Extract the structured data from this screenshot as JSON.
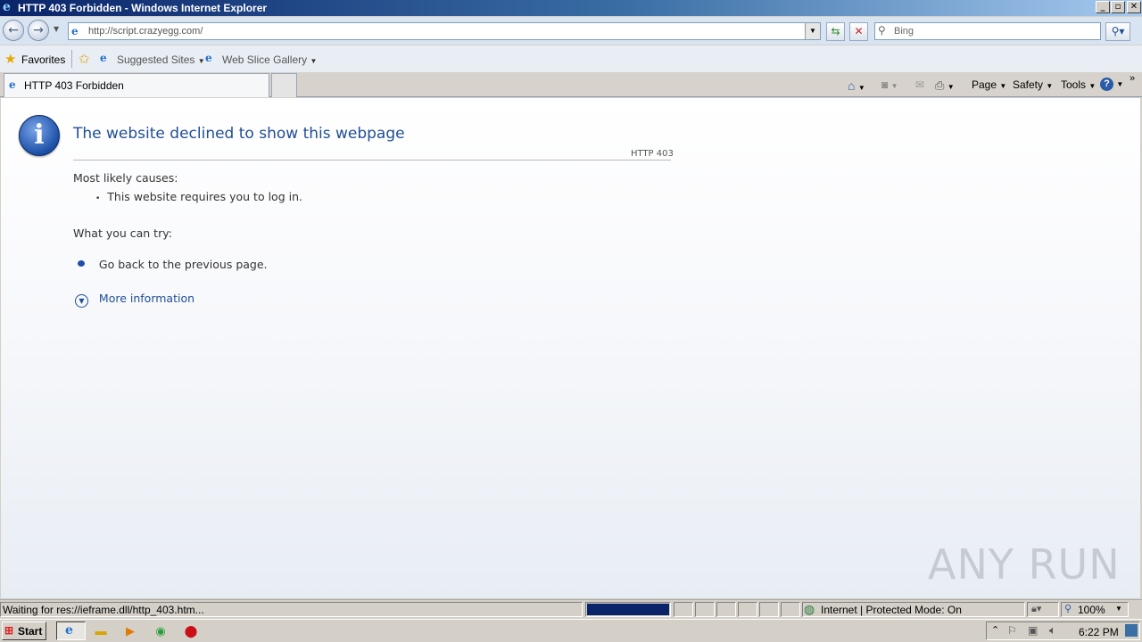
{
  "window": {
    "title": "HTTP 403 Forbidden - Windows Internet Explorer"
  },
  "nav": {
    "address": "http://script.crazyegg.com/",
    "search_placeholder": "Bing"
  },
  "favorites_bar": {
    "favorites_label": "Favorites",
    "suggested_sites": "Suggested Sites",
    "web_slice_gallery": "Web Slice Gallery"
  },
  "tabs": [
    {
      "label": "HTTP 403 Forbidden"
    }
  ],
  "command_bar": {
    "page": "Page",
    "safety": "Safety",
    "tools": "Tools"
  },
  "content": {
    "heading": "The website declined to show this webpage",
    "code": "HTTP 403",
    "causes_title": "Most likely causes:",
    "causes": [
      "This website requires you to log in."
    ],
    "try_title": "What you can try:",
    "try_items": [
      "Go back to the previous page."
    ],
    "more_info": "More information"
  },
  "status_bar": {
    "text": "Waiting for res://ieframe.dll/http_403.htm...",
    "zone": "Internet | Protected Mode: On",
    "zoom": "100%",
    "progress": 1.0
  },
  "taskbar": {
    "start_label": "Start",
    "clock": "6:22 PM"
  },
  "watermark": "ANY RUN",
  "colors": {
    "title_bar": "#0a246a",
    "heading": "#1f4e96",
    "link": "#1f4e96",
    "progress": "#0a246a"
  }
}
